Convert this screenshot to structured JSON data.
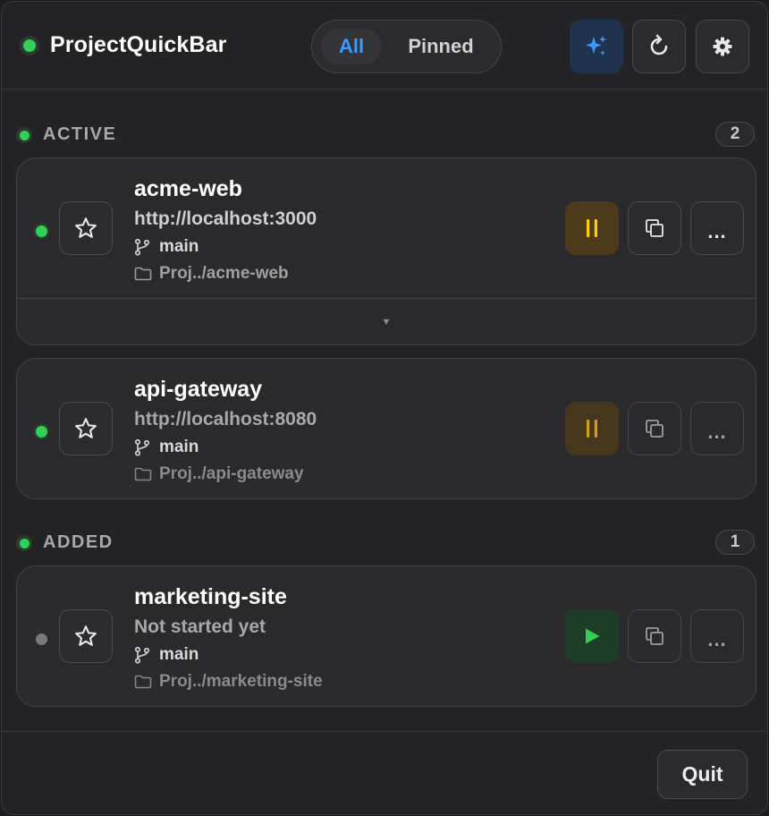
{
  "app": {
    "title": "ProjectQuickBar"
  },
  "filter": {
    "all_label": "All",
    "pinned_label": "Pinned"
  },
  "colors": {
    "accent": "#3a9bff",
    "running": "#30d158",
    "pause": "#ffcc00",
    "play": "#30d158"
  },
  "sections": [
    {
      "title": "ACTIVE",
      "count": "2",
      "projects": [
        {
          "name": "acme-web",
          "status_text": "http://localhost:3000",
          "branch": "main",
          "path": "Proj../acme-web",
          "expand_glyph": "▼"
        },
        {
          "name": "api-gateway",
          "status_text": "http://localhost:8080",
          "branch": "main",
          "path": "Proj../api-gateway"
        }
      ]
    },
    {
      "title": "ADDED",
      "count": "1",
      "projects": [
        {
          "name": "marketing-site",
          "status_text": "Not started yet",
          "branch": "main",
          "path": "Proj../marketing-site"
        }
      ]
    }
  ],
  "footer": {
    "quit_label": "Quit"
  },
  "icons": {
    "sparkle": "sparkle-icon",
    "refresh": "refresh-icon",
    "gear": "gear-icon",
    "star": "star-icon",
    "pause": "pause-icon",
    "play": "play-icon",
    "copy": "copy-icon",
    "more": "more-icon",
    "branch": "git-branch-icon",
    "folder": "folder-icon",
    "chevron": "chevron-down-icon"
  }
}
